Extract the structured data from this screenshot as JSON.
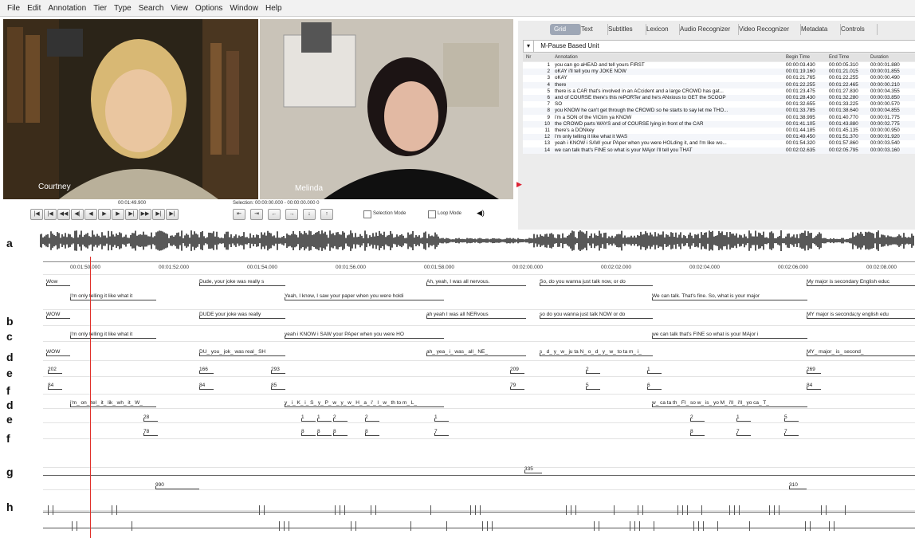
{
  "menu": [
    "File",
    "Edit",
    "Annotation",
    "Tier",
    "Type",
    "Search",
    "View",
    "Options",
    "Window",
    "Help"
  ],
  "video": {
    "left_name": "Courtney",
    "right_name": "Melinda"
  },
  "player": {
    "time": "00:01:49.900",
    "selection": "Selection: 00:00:00.000 - 00:00:00.000  0",
    "selection_mode": "Selection Mode",
    "loop_mode": "Loop Mode",
    "buttons": [
      "|◀",
      "|◀",
      "◀◀",
      "◀|",
      "◀",
      "▶",
      "▶",
      "▶|",
      "▶▶",
      "▶|",
      "▶|"
    ],
    "nav_buttons": [
      "⇤",
      "⇥",
      "←",
      "→",
      "↓",
      "↑"
    ]
  },
  "panel": {
    "tabs": [
      "Grid",
      "Text",
      "Subtitles",
      "Lexicon",
      "Audio Recognizer",
      "Video Recognizer",
      "Metadata",
      "Controls"
    ],
    "active_tab": "Grid",
    "tier": "M-Pause Based Unit",
    "columns": [
      "Nr",
      "Annotation",
      "Begin Time",
      "End Time",
      "Duration"
    ],
    "rows": [
      {
        "nr": "1",
        "text": "you can go aHEAD and tell yours FIRST",
        "begin": "00:00:03.430",
        "end": "00:00:05.310",
        "dur": "00:00:01.880"
      },
      {
        "nr": "2",
        "text": "oKAY i'll tell you my JOKE NOW",
        "begin": "00:01:19.160",
        "end": "00:01:21.015",
        "dur": "00:00:01.855"
      },
      {
        "nr": "3",
        "text": "oKAY",
        "begin": "00:01:21.765",
        "end": "00:01:22.255",
        "dur": "00:00:00.490"
      },
      {
        "nr": "4",
        "text": "there",
        "begin": "00:01:22.255",
        "end": "00:01:22.465",
        "dur": "00:00:00.210"
      },
      {
        "nr": "5",
        "text": "there is a CAR that's involved in an ACcident and a large CROWD has gat...",
        "begin": "00:01:23.475",
        "end": "00:01:27.830",
        "dur": "00:00:04.355"
      },
      {
        "nr": "6",
        "text": "and of COURSE there's this rePORTer and he's ANxious to GET the SCOOP",
        "begin": "00:01:28.430",
        "end": "00:01:32.280",
        "dur": "00:00:03.850"
      },
      {
        "nr": "7",
        "text": "SO",
        "begin": "00:01:32.655",
        "end": "00:01:33.225",
        "dur": "00:00:00.570"
      },
      {
        "nr": "8",
        "text": "you KNOW he can't get through the CROWD so he starts to say let me THO...",
        "begin": "00:01:33.785",
        "end": "00:01:38.640",
        "dur": "00:00:04.855"
      },
      {
        "nr": "9",
        "text": "i'm a SON of the VICtim ya KNOW",
        "begin": "00:01:38.995",
        "end": "00:01:40.770",
        "dur": "00:00:01.775"
      },
      {
        "nr": "10",
        "text": "the CROWD parts WAYS and of COURSE lying in front of the CAR",
        "begin": "00:01:41.105",
        "end": "00:01:43.880",
        "dur": "00:00:02.775"
      },
      {
        "nr": "11",
        "text": "there's a DONkey",
        "begin": "00:01:44.185",
        "end": "00:01:45.135",
        "dur": "00:00:00.950"
      },
      {
        "nr": "12",
        "text": "i'm only telling it like what it WAS",
        "begin": "00:01:49.450",
        "end": "00:01:51.370",
        "dur": "00:00:01.920"
      },
      {
        "nr": "13",
        "text": "yeah i KNOW i SAW your PAper when you were HOLding it, and I'm like wo...",
        "begin": "00:01:54.320",
        "end": "00:01:57.860",
        "dur": "00:00:03.540"
      },
      {
        "nr": "14",
        "text": "we can talk that's FINE so what is your MAjor i'll tell you THAT",
        "begin": "00:02:02.635",
        "end": "00:02:05.795",
        "dur": "00:00:03.160"
      }
    ]
  },
  "tracks": {
    "labels": [
      "a",
      "b",
      "c",
      "d",
      "e",
      "f",
      "d",
      "e",
      "f",
      "g",
      "h"
    ],
    "times": [
      "00:01:50.000",
      "00:01:52.000",
      "00:01:54.000",
      "00:01:56.000",
      "00:01:58.000",
      "00:02:00.000",
      "00:02:02.000",
      "00:02:04.000",
      "00:02:06.000",
      "00:02:08.000"
    ],
    "b1": [
      "Wow",
      "Dude, your joke was really s",
      "Ah, yeah, I was all nervous.",
      "So, do you wanna just talk now, or do",
      "My major is secondary English educ"
    ],
    "b2": [
      "I'm only telling it like what it",
      "Yeah, I know, I saw your paper when you were holdi",
      "We can talk. That's fine. So, what is your major"
    ],
    "c1": [
      "WOW",
      "DUDE your joke was really",
      "ah yeah I was all NERvous",
      "so do you wanna just talk NOW or do",
      "MY major is seconda;ry english edu"
    ],
    "c2": [
      "I'm only telling it like what it",
      "yeah i KNOW i SAW your PAper when you were HO",
      "we can talk that's FINE so what is your MAjor i"
    ],
    "d1": [
      "WOW",
      "DU_ you_ jok_ was real_ SH",
      "ah_ yea_ i_ was_ all_ NE_",
      "s_ d_ y_ w_ ju ta N_ o_ d_ y_ w_ to ta m_ i_",
      "MY_ major_ is_ second_"
    ],
    "e1": [
      "202",
      "166",
      "293",
      "209",
      "2",
      "1",
      "269"
    ],
    "f1": [
      "84",
      "84",
      "85",
      "79",
      "5",
      "6",
      "84"
    ],
    "d2": [
      "i'm_ on_ tel_ it_ lik_ wh_ it_ W_",
      "y_ i_ K_ i_ S_ y_ P_ w_ y_ w_ H_ a_ i'_ l_ w_ th to m_ L_",
      "w_ ca ta th_ FI_ so w_ is_ yo M_ i'll_ i'll_ yo ca_ T_"
    ],
    "e2": [
      "28",
      "1",
      "1",
      "2",
      "2",
      "1",
      "2",
      "1",
      "5"
    ],
    "f2": [
      "78",
      "8",
      "8",
      "8",
      "8",
      "7",
      "8",
      "7",
      "7"
    ],
    "g": [
      "990",
      "335",
      "310"
    ]
  }
}
